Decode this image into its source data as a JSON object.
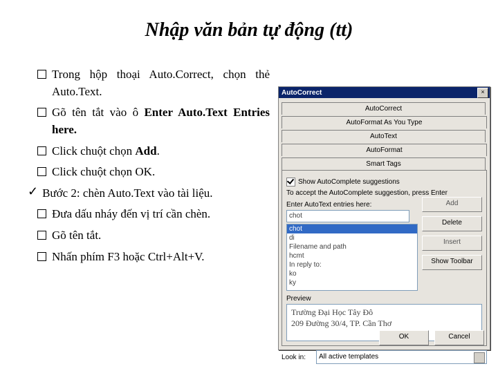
{
  "title": "Nhập văn bản tự động (tt)",
  "left": {
    "items": {
      "0": "Trong hộp thoại Auto.Correct, chọn thẻ Auto.Text.",
      "1a": "Gõ tên tắt vào ô",
      "1b": "Enter Auto.Text Entries here.",
      "2a": "Click chuột chọn",
      "2b": "Add",
      "3": "Click chuột chọn OK.",
      "4": "Đưa dấu nháy đến vị trí cần chèn.",
      "5": "Gõ tên tắt.",
      "6": "Nhấn phím F3 hoặc Ctrl+Alt+V."
    },
    "step2": "Bước 2: chèn Auto.Text vào tài liệu."
  },
  "dialog": {
    "title": "AutoCorrect",
    "tabs": [
      "AutoCorrect",
      "AutoFormat As You Type",
      "AutoText",
      "AutoFormat",
      "Smart Tags"
    ],
    "show_ac": "Show AutoComplete suggestions",
    "accept_hint": "To accept the AutoComplete suggestion, press Enter",
    "enter_label": "Enter AutoText entries here:",
    "entry_value": "chot",
    "list": [
      "chot",
      "di",
      "Filename and path",
      "hcmt",
      "In reply to:",
      "ko",
      "ky"
    ],
    "btn_add": "Add",
    "btn_delete": "Delete",
    "btn_insert": "Insert",
    "btn_toolbar": "Show Toolbar",
    "preview_label": "Preview",
    "preview": [
      "Trường Đại Học Tây Đô",
      "209 Đường 30/4, TP. Cần Thơ"
    ],
    "lookin_label": "Look in:",
    "lookin_value": "All active templates",
    "btn_ok": "OK",
    "btn_cancel": "Cancel"
  }
}
